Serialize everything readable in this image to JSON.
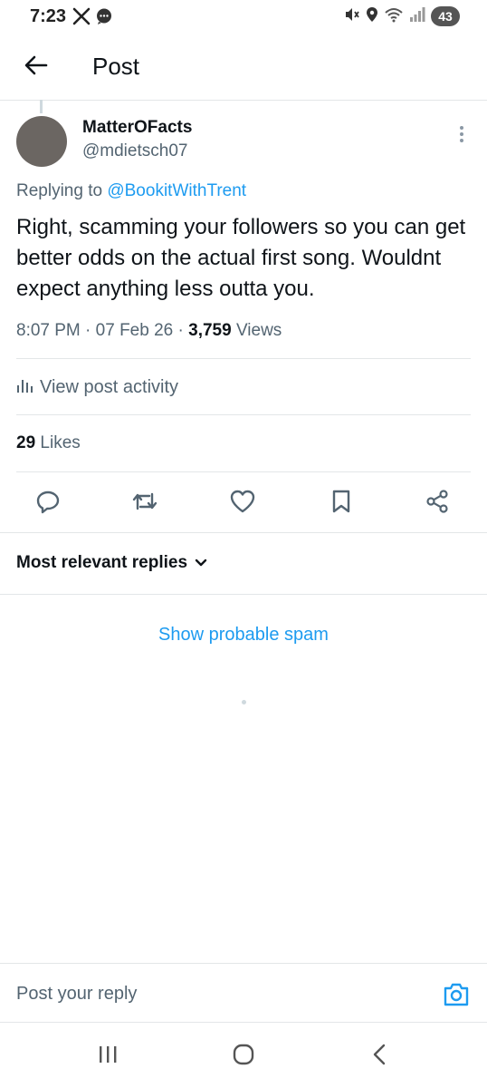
{
  "status_bar": {
    "time": "7:23",
    "battery": "43",
    "icons": [
      "x-logo-icon",
      "message-icon",
      "mute-icon",
      "location-icon",
      "wifi-icon",
      "signal-icon",
      "battery-icon"
    ]
  },
  "header": {
    "title": "Post",
    "back_icon": "arrow-left-icon"
  },
  "post": {
    "author_name": "MatterOFacts",
    "author_handle": "@mdietsch07",
    "replying_prefix": "Replying to",
    "replying_to": "@BookitWithTrent",
    "text": "Right, scamming your followers so you can get better odds on the actual first song. Wouldnt expect anything less outta you.",
    "time": "8:07 PM",
    "date": "07 Feb 26",
    "views_count": "3,759",
    "views_label": "Views",
    "activity_label": "View post activity",
    "likes_count": "29",
    "likes_label": "Likes"
  },
  "actions": [
    "reply-icon",
    "repost-icon",
    "like-icon",
    "bookmark-icon",
    "share-icon"
  ],
  "replies": {
    "sort_label": "Most relevant replies",
    "spam_link": "Show probable spam"
  },
  "composer": {
    "placeholder": "Post your reply"
  },
  "colors": {
    "accent": "#1d9bf0",
    "text_primary": "#0f1419",
    "text_secondary": "#536471",
    "divider": "#e3e6e8"
  }
}
